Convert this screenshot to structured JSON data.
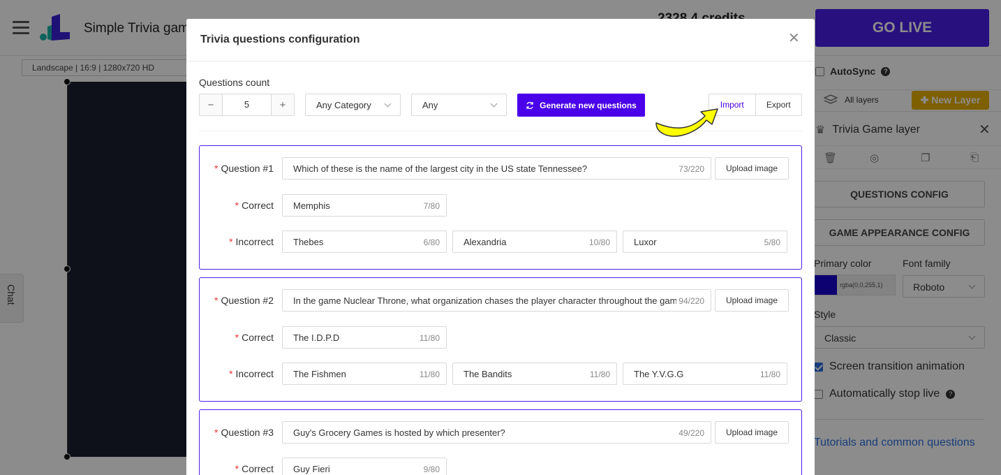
{
  "app": {
    "title": "Simple Trivia game",
    "credits": "2328.4 credits",
    "go_live": "GO LIVE",
    "resolution": "Landscape | 16:9 | 1280x720 HD",
    "chat": "Chat"
  },
  "right_panel": {
    "autosync": "AutoSync",
    "all_layers": "All layers",
    "new_layer": "New Layer",
    "layer_title": "Trivia Game layer",
    "questions_config": "QUESTIONS CONFIG",
    "game_appearance_config": "GAME APPEARANCE CONFIG",
    "primary_color_label": "Primary color",
    "primary_color_value": "rgba(0,0,255,1)",
    "font_family_label": "Font family",
    "font_family_value": "Roboto",
    "style_label": "Style",
    "style_value": "Classic",
    "screen_transition": "Screen transition animation",
    "auto_stop": "Automatically stop live",
    "tutorials": "Tutorials and common questions"
  },
  "modal": {
    "title": "Trivia questions configuration",
    "questions_count_label": "Questions count",
    "questions_count": "5",
    "category": "Any Category",
    "difficulty": "Any",
    "generate": "Generate new questions",
    "import": "Import",
    "export": "Export",
    "upload_image": "Upload image",
    "labels": {
      "question_prefix": "Question #",
      "correct": "Correct",
      "incorrect": "Incorrect"
    },
    "questions": [
      {
        "label": "Question #1",
        "text": "Which of these is the name of the largest city in the US state Tennessee?",
        "text_count": "73/220",
        "correct": "Memphis",
        "correct_count": "7/80",
        "incorrect": [
          {
            "text": "Thebes",
            "count": "6/80"
          },
          {
            "text": "Alexandria",
            "count": "10/80"
          },
          {
            "text": "Luxor",
            "count": "5/80"
          }
        ]
      },
      {
        "label": "Question #2",
        "text": "In the game Nuclear Throne, what organization chases the player character throughout the game?",
        "text_count": "94/220",
        "correct": "The I.D.P.D",
        "correct_count": "11/80",
        "incorrect": [
          {
            "text": "The Fishmen",
            "count": "11/80"
          },
          {
            "text": "The Bandits",
            "count": "11/80"
          },
          {
            "text": "The Y.V.G.G",
            "count": "11/80"
          }
        ]
      },
      {
        "label": "Question #3",
        "text": "Guy's Grocery Games is hosted by which presenter?",
        "text_count": "49/220",
        "correct": "Guy Fieri",
        "correct_count": "9/80"
      }
    ]
  },
  "colors": {
    "accent": "#4a00e8",
    "go_live": "#4a1ee6",
    "new_layer": "#e6b000",
    "required": "#ee3333",
    "arrow": "#ffff00"
  }
}
